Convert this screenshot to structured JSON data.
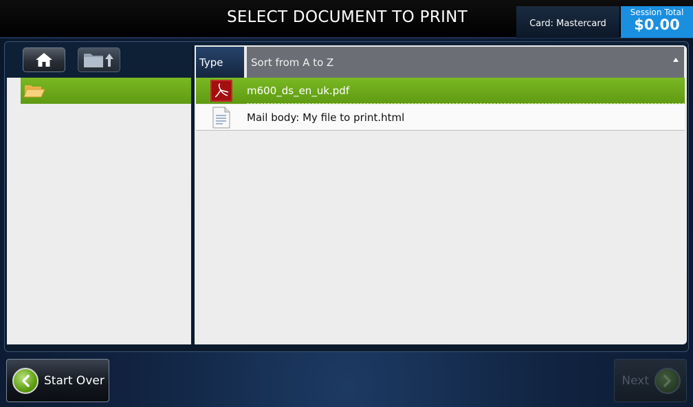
{
  "header": {
    "title": "SELECT DOCUMENT TO PRINT",
    "card_label": "Card: Mastercard",
    "session_label": "Session Total",
    "session_amount": "$0.00"
  },
  "toolbar": {
    "home_icon": "home-icon",
    "up_icon": "folder-up-icon"
  },
  "tree": {
    "items": [
      {
        "icon": "open-folder-icon",
        "label": ""
      }
    ]
  },
  "list": {
    "columns": {
      "type": "Type",
      "name": "Sort from A to Z"
    },
    "rows": [
      {
        "icon": "pdf-icon",
        "name": "m600_ds_en_uk.pdf",
        "selected": true
      },
      {
        "icon": "document-icon",
        "name": "Mail body: My file to print.html",
        "selected": false
      }
    ]
  },
  "footer": {
    "start_over_label": "Start Over",
    "next_label": "Next"
  },
  "colors": {
    "accent_green": "#6aa81a",
    "session_blue": "#1a8fe0",
    "background": "#10223f"
  }
}
